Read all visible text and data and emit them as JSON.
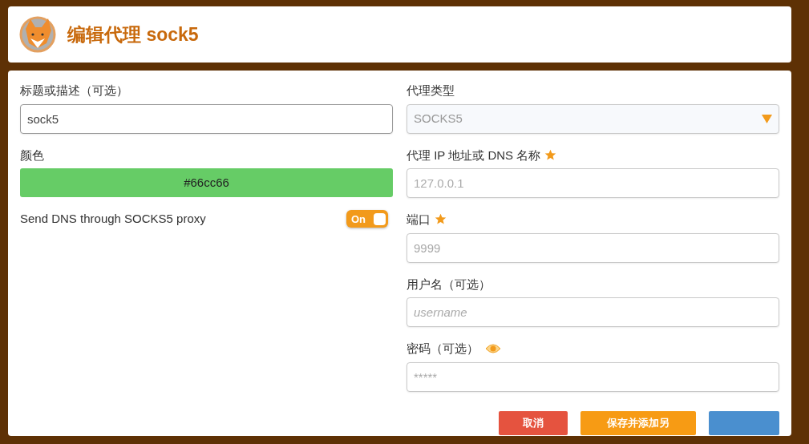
{
  "header": {
    "title": "编辑代理 sock5"
  },
  "left": {
    "title_label": "标题或描述（可选）",
    "title_value": "sock5",
    "color_label": "颜色",
    "color": "#66cc66",
    "color_text": "#66cc66",
    "dns_label": "Send DNS through SOCKS5 proxy",
    "dns_toggle": {
      "on": true,
      "label": "On"
    }
  },
  "right": {
    "fields": [
      {
        "kind": "select",
        "label": "代理类型",
        "value": "SOCKS5",
        "required": false
      },
      {
        "kind": "input",
        "label": "代理 IP 地址或 DNS 名称",
        "placeholder": "127.0.0.1",
        "required": true
      },
      {
        "kind": "input",
        "label": "端口",
        "placeholder": "9999",
        "required": true
      },
      {
        "kind": "input",
        "label": "用户名（可选）",
        "placeholder": "username",
        "required": false,
        "italic": true
      },
      {
        "kind": "password",
        "label": "密码（可选）",
        "placeholder": "*****",
        "required": false
      }
    ]
  },
  "buttons": [
    {
      "kind": "cancel",
      "label": "取消"
    },
    {
      "kind": "save-add",
      "label": "保存并添加另"
    },
    {
      "kind": "save"
    }
  ]
}
